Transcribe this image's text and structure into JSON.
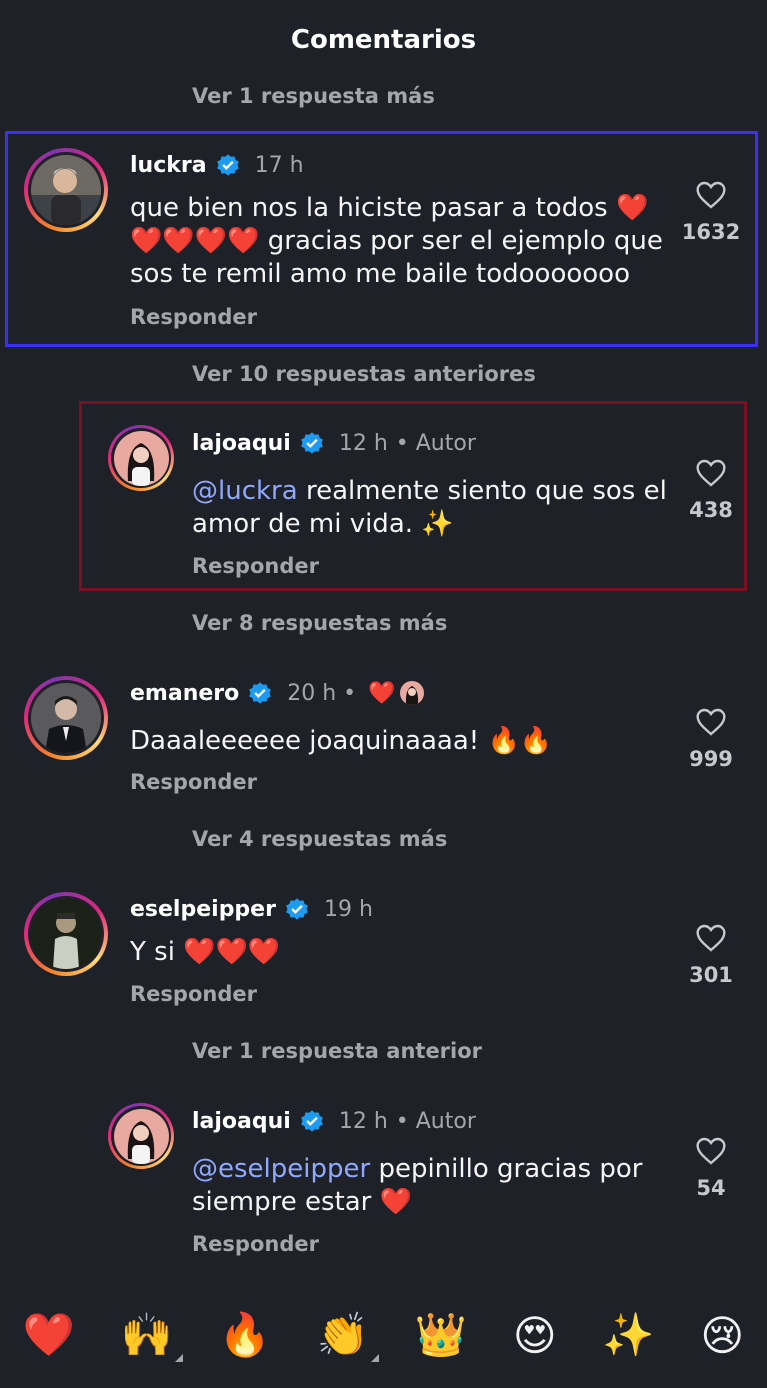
{
  "header": {
    "title": "Comentarios"
  },
  "view_more": [
    "Ver 1 respuesta más",
    "Ver 10 respuestas anteriores",
    "Ver 8 respuestas más",
    "Ver 4 respuestas más",
    "Ver 1 respuesta anterior"
  ],
  "comments": [
    {
      "username": "luckra",
      "time": "17 h",
      "text": "que bien nos la hiciste pasar a todos ❤️❤️❤️❤️❤️ gracias por ser el ejemplo que sos te remil amo me baile todooooooo",
      "reply_label": "Responder",
      "likes": "1632"
    },
    {
      "username": "lajoaqui",
      "time": "12 h",
      "author_tag": "• Autor",
      "mention": "@luckra",
      "text": " realmente siento que sos el amor de mi vida. ✨",
      "reply_label": "Responder",
      "likes": "438"
    },
    {
      "username": "emanero",
      "time": "20 h •",
      "reaction": "❤️",
      "text": "Daaaleeeeee joaquinaaaa! 🔥🔥",
      "reply_label": "Responder",
      "likes": "999"
    },
    {
      "username": "eselpeipper",
      "time": "19 h",
      "text": "Y si ❤️❤️❤️",
      "reply_label": "Responder",
      "likes": "301"
    },
    {
      "username": "lajoaqui",
      "time": "12 h",
      "author_tag": "• Autor",
      "mention": "@eselpeipper",
      "text": " pepinillo gracias por siempre estar ❤️",
      "reply_label": "Responder",
      "likes": "54"
    }
  ],
  "emoji_bar": [
    "❤️",
    "🙌",
    "🔥",
    "👏",
    "👑",
    "😍",
    "✨",
    "😢"
  ],
  "colors": {
    "background": "#1f2128",
    "verified": "#1d9bf0",
    "mention": "#8ea9ff"
  }
}
